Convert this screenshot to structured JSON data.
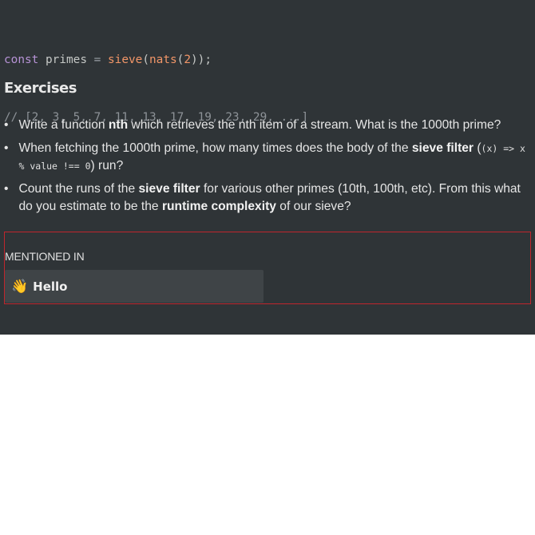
{
  "code": {
    "line1": {
      "kw": "const",
      "ident": "primes",
      "op": "=",
      "fn1": "sieve",
      "paren_open": "(",
      "fn2": "nats",
      "paren_open2": "(",
      "num": "2",
      "paren_close": "));"
    },
    "line2": "// [2, 3, 5, 7, 11, 13, 17, 19, 23, 29, ...]"
  },
  "exercises": {
    "heading": "Exercises",
    "items": [
      {
        "t1": "Write a function ",
        "b1": "nth",
        "t2": " which retrieves the nth item of a stream. What is the 1000th prime?"
      },
      {
        "t1": "When fetching the 1000th prime, how many times does the body of the ",
        "b1": "sieve filter",
        "t2": " (",
        "code": "(x) => x % value !== 0",
        "t3": ") run?"
      },
      {
        "t1": "Count the runs of the ",
        "b1": "sieve filter",
        "t2": " for various other primes (10th, 100th, etc). From this what do you estimate to be the ",
        "b2": "runtime complexity",
        "t3": " of our sieve?"
      }
    ]
  },
  "mentioned": {
    "label": "MENTIONED IN",
    "card": {
      "icon": "waving-hand-icon",
      "emoji": "👋",
      "title": "Hello"
    }
  },
  "colors": {
    "panel_bg": "#2f3437",
    "highlight_border": "#c0262d",
    "card_bg": "#3f4447",
    "keyword": "#b793d6",
    "function": "#f29668"
  }
}
